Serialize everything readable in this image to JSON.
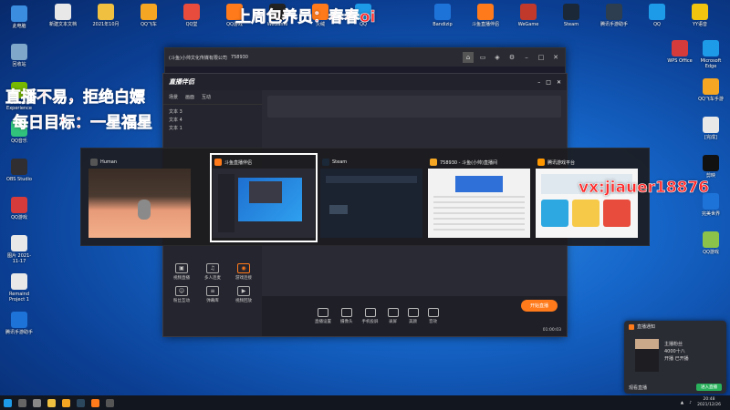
{
  "overlay": {
    "title_banner": "上周包养员：春春oi",
    "line1": "直播不易，拒绝白嫖",
    "line2": "每日目标：一星福星",
    "contact": "vx:jiauer18876"
  },
  "desktop_icons_left": [
    {
      "label": "此电脑",
      "color": "#3b8de0"
    },
    {
      "label": "回收站",
      "color": "#7fa7c9"
    },
    {
      "label": "GeForce Experience",
      "color": "#76b900"
    },
    {
      "label": "QQ音乐",
      "color": "#31c27c"
    },
    {
      "label": "OBS Studio",
      "color": "#302e31"
    },
    {
      "label": "QQ游戏",
      "color": "#d63b3b"
    },
    {
      "label": "图片 2021-11-17",
      "color": "#e8e8e8"
    },
    {
      "label": "Remaind Project 1",
      "color": "#e8e8e8"
    },
    {
      "label": "腾讯手游助手",
      "color": "#1e73d8"
    }
  ],
  "desktop_icons_top": [
    {
      "label": "新建文本文档",
      "color": "#e8e8e8"
    },
    {
      "label": "2021年10月",
      "color": "#f0c040"
    },
    {
      "label": "QQ飞车",
      "color": "#f5a623"
    },
    {
      "label": "QQ堂",
      "color": "#e74c3c"
    },
    {
      "label": "QQ游戏",
      "color": "#ff7a1a"
    },
    {
      "label": "WeGame",
      "color": "#222222"
    },
    {
      "label": "火绒",
      "color": "#ff7a1a"
    },
    {
      "label": "QQ",
      "color": "#1e9be8"
    },
    {
      "label": "Bandizip",
      "color": "#1e73d8"
    },
    {
      "label": "斗鱼直播伴侣",
      "color": "#ff7a1a"
    },
    {
      "label": "WeGame",
      "color": "#c0392b"
    },
    {
      "label": "Steam",
      "color": "#1b2838"
    },
    {
      "label": "腾讯手游助手",
      "color": "#2c3e50"
    },
    {
      "label": "QQ",
      "color": "#1e9be8"
    },
    {
      "label": "YY语音",
      "color": "#f1c40f"
    }
  ],
  "desktop_icons_right": [
    {
      "label": "WPS Office",
      "color": "#d63b3b"
    },
    {
      "label": "Microsoft Edge",
      "color": "#1e9be8"
    },
    {
      "label": "QQ飞车手游",
      "color": "#f5a623"
    },
    {
      "label": "[完成]",
      "color": "#e8e8e8"
    },
    {
      "label": "剪映",
      "color": "#111111"
    },
    {
      "label": "完美世界",
      "color": "#1e73d8"
    },
    {
      "label": "QQ游戏",
      "color": "#8bc34a"
    }
  ],
  "browser": {
    "tab_title": "(斗鱼)小帅文化传媒有限公司",
    "room_id": "758930",
    "controls": [
      "home-icon",
      "screen-icon",
      "gamepad-icon",
      "settings-icon",
      "minimize-icon",
      "maximize-icon",
      "close-icon"
    ]
  },
  "app": {
    "logo": "直播伴侣",
    "sidebar_tabs": [
      "场景",
      "画面",
      "互动"
    ],
    "sources": [
      "文本 3",
      "文本 4",
      "文本 1"
    ],
    "tools": [
      {
        "label": "视频直播",
        "accent": false
      },
      {
        "label": "多人连麦",
        "accent": false
      },
      {
        "label": "游戏连接",
        "accent": true
      },
      {
        "label": "粉丝互动",
        "accent": false
      },
      {
        "label": "弹幕库",
        "accent": false
      },
      {
        "label": "视频回放",
        "accent": false
      }
    ],
    "bottom_tools": [
      "直播设置",
      "摄像头",
      "手机投屏",
      "录屏",
      "美颜",
      "音效",
      "弹幕",
      "设置"
    ],
    "go_live": "开始直播",
    "stats": "01:00:03"
  },
  "switcher": {
    "windows": [
      {
        "title": "Human",
        "selected": false,
        "icon_color": "#555555"
      },
      {
        "title": "斗鱼直播伴侣",
        "selected": true,
        "icon_color": "#ff7a1a"
      },
      {
        "title": "Steam",
        "selected": false,
        "icon_color": "#1b2838"
      },
      {
        "title": "758930 - 斗鱼(小帅)直播间",
        "selected": false,
        "icon_color": "#f5a623"
      },
      {
        "title": "腾讯游戏平台",
        "selected": false,
        "icon_color": "#ff9800"
      }
    ]
  },
  "notification": {
    "title": "直播通知",
    "body_line1": "主播粉丝",
    "body_line2": "4000十八",
    "body_line3": "开播 已开播",
    "footer": "观看直播",
    "button": "进入直播"
  },
  "taskbar": {
    "apps": [
      "start-icon",
      "search-icon",
      "taskview-icon",
      "explorer-icon",
      "folder-icon",
      "steam-icon",
      "douyu-icon",
      "game-icon"
    ],
    "time": "20:48",
    "date": "2021/12/26"
  }
}
